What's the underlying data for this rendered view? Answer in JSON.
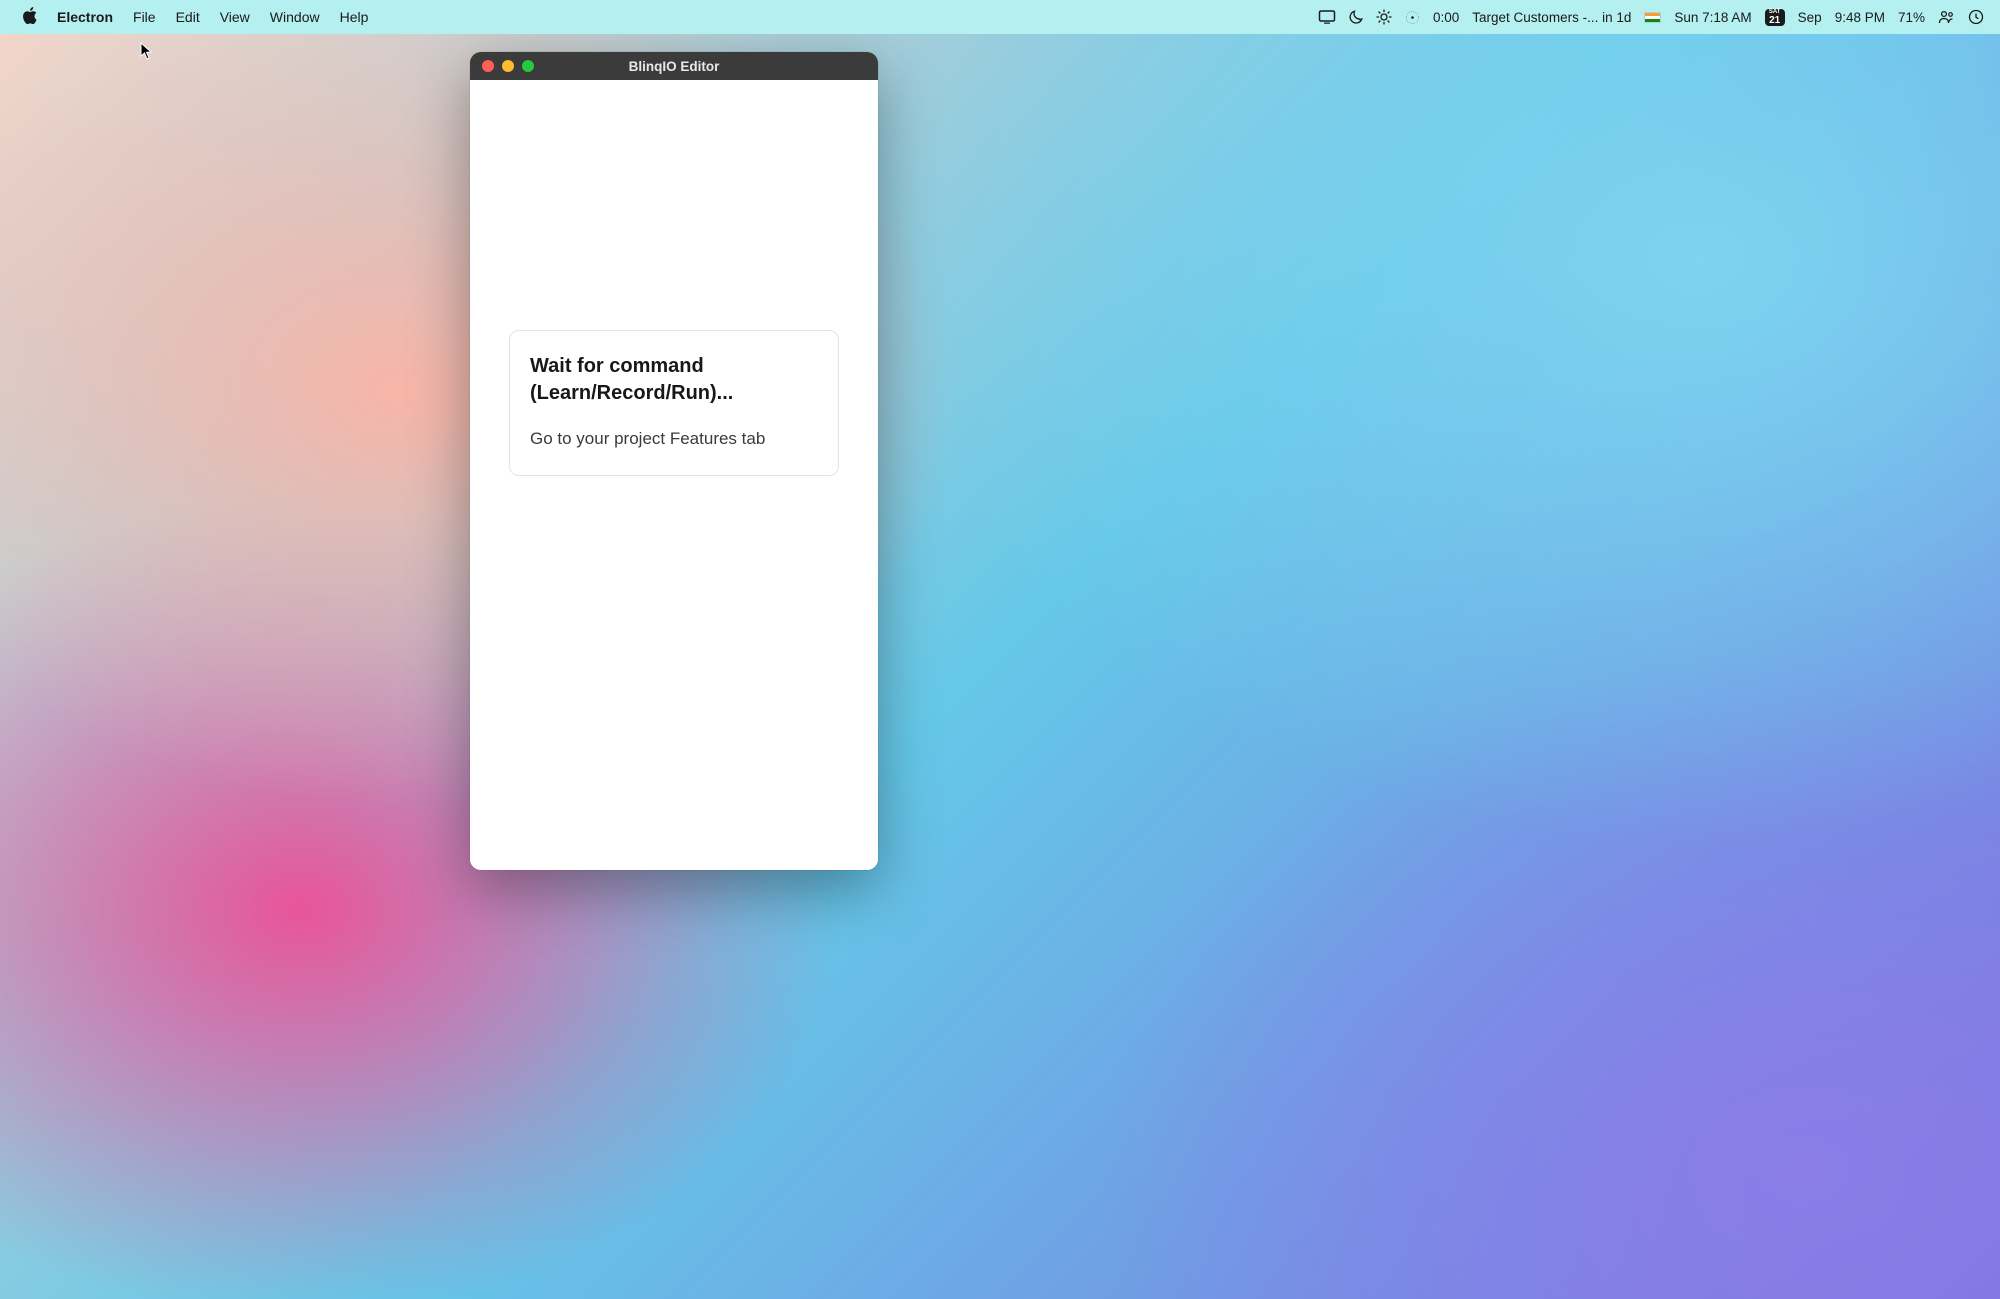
{
  "menubar": {
    "app_active": "Electron",
    "items": [
      "File",
      "Edit",
      "View",
      "Window",
      "Help"
    ],
    "status": {
      "timer": "0:00",
      "task": "Target Customers -... in 1d",
      "clock_secondary": "Sun 7:18 AM",
      "cal_label": "SAT",
      "cal_day": "21",
      "month": "Sep",
      "clock_primary": "9:48 PM",
      "battery": "71%"
    }
  },
  "window": {
    "title": "BlinqIO Editor",
    "card_heading": "Wait for command (Learn/Record/Run)...",
    "card_body": "Go to your project Features tab"
  }
}
